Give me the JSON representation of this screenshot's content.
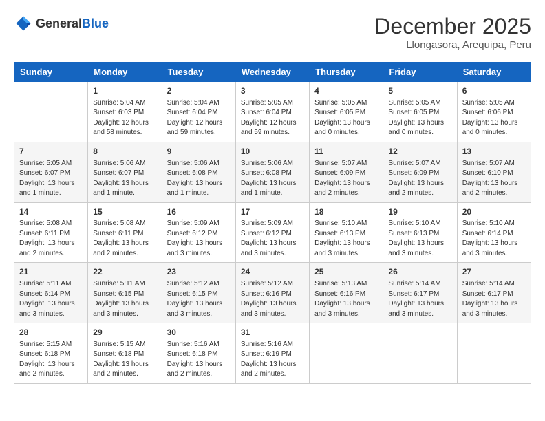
{
  "logo": {
    "text_general": "General",
    "text_blue": "Blue"
  },
  "header": {
    "month_year": "December 2025",
    "location": "Llongasora, Arequipa, Peru"
  },
  "days_of_week": [
    "Sunday",
    "Monday",
    "Tuesday",
    "Wednesday",
    "Thursday",
    "Friday",
    "Saturday"
  ],
  "weeks": [
    [
      {
        "day": "",
        "info": ""
      },
      {
        "day": "1",
        "info": "Sunrise: 5:04 AM\nSunset: 6:03 PM\nDaylight: 12 hours\nand 58 minutes."
      },
      {
        "day": "2",
        "info": "Sunrise: 5:04 AM\nSunset: 6:04 PM\nDaylight: 12 hours\nand 59 minutes."
      },
      {
        "day": "3",
        "info": "Sunrise: 5:05 AM\nSunset: 6:04 PM\nDaylight: 12 hours\nand 59 minutes."
      },
      {
        "day": "4",
        "info": "Sunrise: 5:05 AM\nSunset: 6:05 PM\nDaylight: 13 hours\nand 0 minutes."
      },
      {
        "day": "5",
        "info": "Sunrise: 5:05 AM\nSunset: 6:05 PM\nDaylight: 13 hours\nand 0 minutes."
      },
      {
        "day": "6",
        "info": "Sunrise: 5:05 AM\nSunset: 6:06 PM\nDaylight: 13 hours\nand 0 minutes."
      }
    ],
    [
      {
        "day": "7",
        "info": "Sunrise: 5:05 AM\nSunset: 6:07 PM\nDaylight: 13 hours\nand 1 minute."
      },
      {
        "day": "8",
        "info": "Sunrise: 5:06 AM\nSunset: 6:07 PM\nDaylight: 13 hours\nand 1 minute."
      },
      {
        "day": "9",
        "info": "Sunrise: 5:06 AM\nSunset: 6:08 PM\nDaylight: 13 hours\nand 1 minute."
      },
      {
        "day": "10",
        "info": "Sunrise: 5:06 AM\nSunset: 6:08 PM\nDaylight: 13 hours\nand 1 minute."
      },
      {
        "day": "11",
        "info": "Sunrise: 5:07 AM\nSunset: 6:09 PM\nDaylight: 13 hours\nand 2 minutes."
      },
      {
        "day": "12",
        "info": "Sunrise: 5:07 AM\nSunset: 6:09 PM\nDaylight: 13 hours\nand 2 minutes."
      },
      {
        "day": "13",
        "info": "Sunrise: 5:07 AM\nSunset: 6:10 PM\nDaylight: 13 hours\nand 2 minutes."
      }
    ],
    [
      {
        "day": "14",
        "info": "Sunrise: 5:08 AM\nSunset: 6:11 PM\nDaylight: 13 hours\nand 2 minutes."
      },
      {
        "day": "15",
        "info": "Sunrise: 5:08 AM\nSunset: 6:11 PM\nDaylight: 13 hours\nand 2 minutes."
      },
      {
        "day": "16",
        "info": "Sunrise: 5:09 AM\nSunset: 6:12 PM\nDaylight: 13 hours\nand 3 minutes."
      },
      {
        "day": "17",
        "info": "Sunrise: 5:09 AM\nSunset: 6:12 PM\nDaylight: 13 hours\nand 3 minutes."
      },
      {
        "day": "18",
        "info": "Sunrise: 5:10 AM\nSunset: 6:13 PM\nDaylight: 13 hours\nand 3 minutes."
      },
      {
        "day": "19",
        "info": "Sunrise: 5:10 AM\nSunset: 6:13 PM\nDaylight: 13 hours\nand 3 minutes."
      },
      {
        "day": "20",
        "info": "Sunrise: 5:10 AM\nSunset: 6:14 PM\nDaylight: 13 hours\nand 3 minutes."
      }
    ],
    [
      {
        "day": "21",
        "info": "Sunrise: 5:11 AM\nSunset: 6:14 PM\nDaylight: 13 hours\nand 3 minutes."
      },
      {
        "day": "22",
        "info": "Sunrise: 5:11 AM\nSunset: 6:15 PM\nDaylight: 13 hours\nand 3 minutes."
      },
      {
        "day": "23",
        "info": "Sunrise: 5:12 AM\nSunset: 6:15 PM\nDaylight: 13 hours\nand 3 minutes."
      },
      {
        "day": "24",
        "info": "Sunrise: 5:12 AM\nSunset: 6:16 PM\nDaylight: 13 hours\nand 3 minutes."
      },
      {
        "day": "25",
        "info": "Sunrise: 5:13 AM\nSunset: 6:16 PM\nDaylight: 13 hours\nand 3 minutes."
      },
      {
        "day": "26",
        "info": "Sunrise: 5:14 AM\nSunset: 6:17 PM\nDaylight: 13 hours\nand 3 minutes."
      },
      {
        "day": "27",
        "info": "Sunrise: 5:14 AM\nSunset: 6:17 PM\nDaylight: 13 hours\nand 3 minutes."
      }
    ],
    [
      {
        "day": "28",
        "info": "Sunrise: 5:15 AM\nSunset: 6:18 PM\nDaylight: 13 hours\nand 2 minutes."
      },
      {
        "day": "29",
        "info": "Sunrise: 5:15 AM\nSunset: 6:18 PM\nDaylight: 13 hours\nand 2 minutes."
      },
      {
        "day": "30",
        "info": "Sunrise: 5:16 AM\nSunset: 6:18 PM\nDaylight: 13 hours\nand 2 minutes."
      },
      {
        "day": "31",
        "info": "Sunrise: 5:16 AM\nSunset: 6:19 PM\nDaylight: 13 hours\nand 2 minutes."
      },
      {
        "day": "",
        "info": ""
      },
      {
        "day": "",
        "info": ""
      },
      {
        "day": "",
        "info": ""
      }
    ]
  ]
}
